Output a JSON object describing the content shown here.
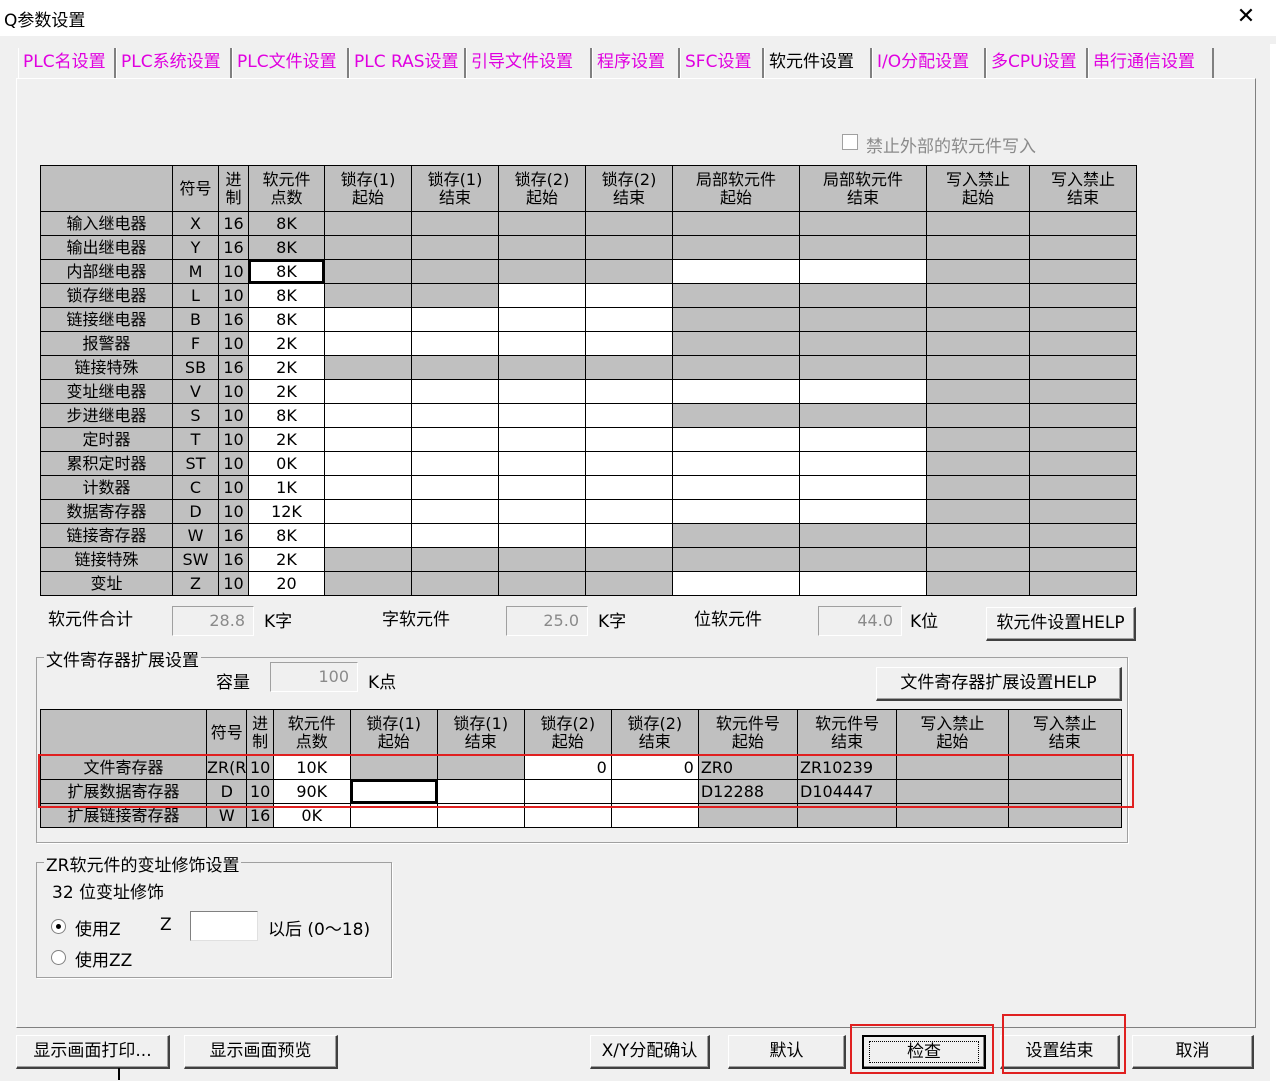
{
  "window": {
    "title": "Q参数设置",
    "close_label": "✕"
  },
  "tabs": [
    {
      "label": "PLC名设置",
      "active": false
    },
    {
      "label": "PLC系统设置",
      "active": false
    },
    {
      "label": "PLC文件设置",
      "active": false
    },
    {
      "label": "PLC RAS设置",
      "active": false
    },
    {
      "label": "引导文件设置",
      "active": false
    },
    {
      "label": "程序设置",
      "active": false
    },
    {
      "label": "SFC设置",
      "active": false
    },
    {
      "label": "软元件设置",
      "active": true
    },
    {
      "label": "I/O分配设置",
      "active": false
    },
    {
      "label": "多CPU设置",
      "active": false
    },
    {
      "label": "串行通信设置",
      "active": false
    }
  ],
  "prohibit_external_write": {
    "label": "禁止外部的软元件写入",
    "checked": false
  },
  "device_table": {
    "headers": [
      "",
      "符号",
      "进制",
      "软元件点数",
      "锁存(1)起始",
      "锁存(1)结束",
      "锁存(2)起始",
      "锁存(2)结束",
      "局部软元件起始",
      "局部软元件结束",
      "写入禁止起始",
      "写入禁止结束"
    ],
    "header_lines": [
      [
        "符号"
      ],
      [
        "进",
        "制"
      ],
      [
        "软元件",
        "点数"
      ],
      [
        "锁存(1)",
        "起始"
      ],
      [
        "锁存(1)",
        "结束"
      ],
      [
        "锁存(2)",
        "起始"
      ],
      [
        "锁存(2)",
        "结束"
      ],
      [
        "局部软元件",
        "起始"
      ],
      [
        "局部软元件",
        "结束"
      ],
      [
        "写入禁止",
        "起始"
      ],
      [
        "写入禁止",
        "结束"
      ]
    ],
    "rows": [
      {
        "name": "输入继电器",
        "symbol": "X",
        "base": "16",
        "points": "8K"
      },
      {
        "name": "输出继电器",
        "symbol": "Y",
        "base": "16",
        "points": "8K"
      },
      {
        "name": "内部继电器",
        "symbol": "M",
        "base": "10",
        "points": "8K"
      },
      {
        "name": "锁存继电器",
        "symbol": "L",
        "base": "10",
        "points": "8K"
      },
      {
        "name": "链接继电器",
        "symbol": "B",
        "base": "16",
        "points": "8K"
      },
      {
        "name": "报警器",
        "symbol": "F",
        "base": "10",
        "points": "2K"
      },
      {
        "name": "链接特殊",
        "symbol": "SB",
        "base": "16",
        "points": "2K"
      },
      {
        "name": "变址继电器",
        "symbol": "V",
        "base": "10",
        "points": "2K"
      },
      {
        "name": "步进继电器",
        "symbol": "S",
        "base": "10",
        "points": "8K"
      },
      {
        "name": "定时器",
        "symbol": "T",
        "base": "10",
        "points": "2K"
      },
      {
        "name": "累积定时器",
        "symbol": "ST",
        "base": "10",
        "points": "0K"
      },
      {
        "name": "计数器",
        "symbol": "C",
        "base": "10",
        "points": "1K"
      },
      {
        "name": "数据寄存器",
        "symbol": "D",
        "base": "10",
        "points": "12K"
      },
      {
        "name": "链接寄存器",
        "symbol": "W",
        "base": "16",
        "points": "8K"
      },
      {
        "name": "链接特殊",
        "symbol": "SW",
        "base": "16",
        "points": "2K"
      },
      {
        "name": "变址",
        "symbol": "Z",
        "base": "10",
        "points": "20"
      }
    ]
  },
  "totals": {
    "total_label": "软元件合计",
    "total_value": "28.8",
    "total_unit": "K字",
    "word_label": "字软元件",
    "word_value": "25.0",
    "word_unit": "K字",
    "bit_label": "位软元件",
    "bit_value": "44.0",
    "bit_unit": "K位",
    "help_button": "软元件设置HELP"
  },
  "file_register_ext": {
    "group_title": "文件寄存器扩展设置",
    "capacity_label": "容量",
    "capacity_value": "100",
    "capacity_unit": "K点",
    "help_button": "文件寄存器扩展设置HELP",
    "header_lines": [
      [
        "符号"
      ],
      [
        "进",
        "制"
      ],
      [
        "软元件",
        "点数"
      ],
      [
        "锁存(1)",
        "起始"
      ],
      [
        "锁存(1)",
        "结束"
      ],
      [
        "锁存(2)",
        "起始"
      ],
      [
        "锁存(2)",
        "结束"
      ],
      [
        "软元件号",
        "起始"
      ],
      [
        "软元件号",
        "结束"
      ],
      [
        "写入禁止",
        "起始"
      ],
      [
        "写入禁止",
        "结束"
      ]
    ],
    "rows": [
      {
        "name": "文件寄存器",
        "symbol": "ZR(R)",
        "base": "10",
        "points": "10K",
        "latch2_start": "0",
        "latch2_end": "0",
        "dev_start": "ZR0",
        "dev_end": "ZR10239"
      },
      {
        "name": "扩展数据寄存器",
        "symbol": "D",
        "base": "10",
        "points": "90K",
        "latch2_start": "",
        "latch2_end": "",
        "dev_start": "D12288",
        "dev_end": "D104447"
      },
      {
        "name": "扩展链接寄存器",
        "symbol": "W",
        "base": "16",
        "points": "0K",
        "latch2_start": "",
        "latch2_end": "",
        "dev_start": "",
        "dev_end": ""
      }
    ]
  },
  "zr_index": {
    "group_title": "ZR软元件的变址修饰设置",
    "sub_label": "32 位变址修饰",
    "use_z_label": "使用Z",
    "z_label": "Z",
    "z_value": "",
    "after_label": "以后 (0～18)",
    "use_zz_label": "使用ZZ",
    "selected": "use_z"
  },
  "buttons": {
    "print": "显示画面打印...",
    "preview": "显示画面预览",
    "xy_confirm": "X/Y分配确认",
    "default": "默认",
    "check": "检查",
    "finish": "设置结束",
    "cancel": "取消"
  },
  "highlight_color": "#e02020"
}
